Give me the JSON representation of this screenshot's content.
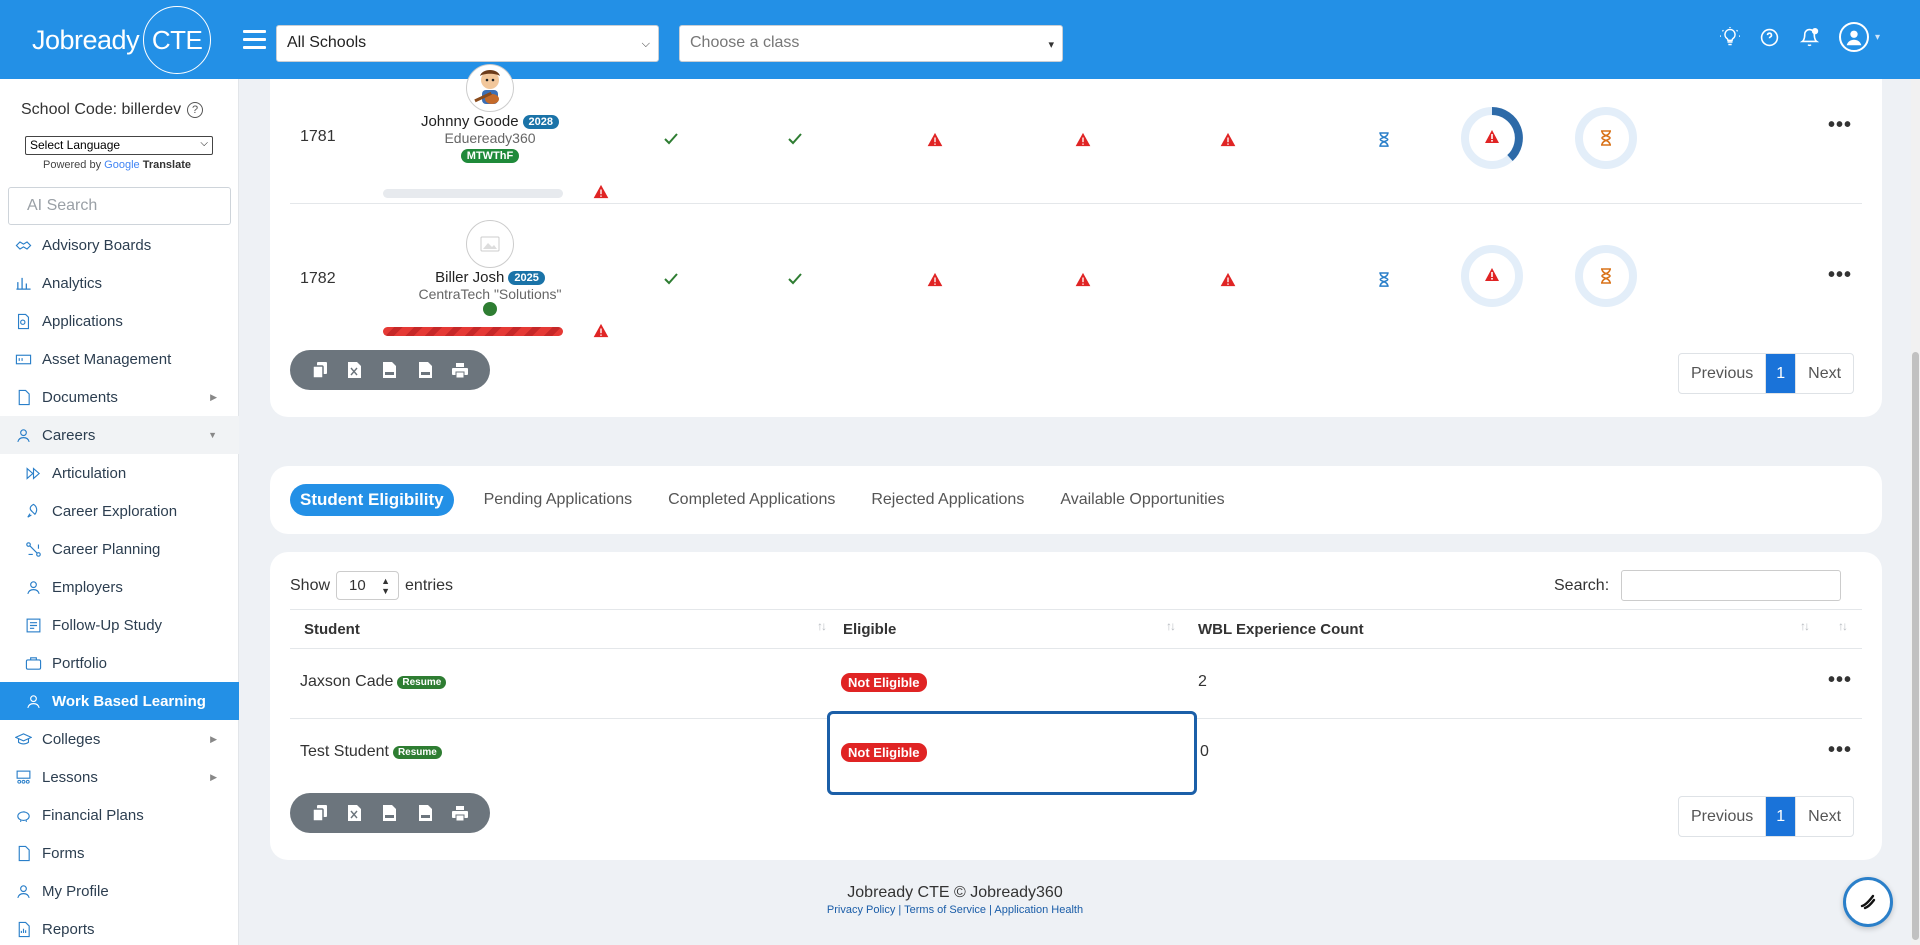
{
  "header": {
    "logo_text": "Jobready",
    "logo_badge": "CTE",
    "school_select": "All Schools",
    "class_select_placeholder": "Choose a class"
  },
  "sidebar": {
    "school_code": "School Code: billerdev",
    "language_select": "Select Language",
    "powered_by": "Powered by",
    "google": "Google",
    "translate": "Translate",
    "ai_search_placeholder": "AI Search",
    "items": [
      {
        "label": "Advisory Boards",
        "icon": "handshake-icon"
      },
      {
        "label": "Analytics",
        "icon": "bar-chart-icon"
      },
      {
        "label": "Applications",
        "icon": "document-search-icon"
      },
      {
        "label": "Asset Management",
        "icon": "asset-icon"
      },
      {
        "label": "Documents",
        "icon": "file-icon",
        "has_children": true
      },
      {
        "label": "Careers",
        "icon": "user-icon",
        "has_children": true,
        "expanded": true
      },
      {
        "label": "Articulation",
        "icon": "fast-forward-icon",
        "sub": true
      },
      {
        "label": "Career Exploration",
        "icon": "rocket-icon",
        "sub": true
      },
      {
        "label": "Career Planning",
        "icon": "flow-icon",
        "sub": true
      },
      {
        "label": "Employers",
        "icon": "user-icon",
        "sub": true
      },
      {
        "label": "Follow-Up Study",
        "icon": "study-icon",
        "sub": true
      },
      {
        "label": "Portfolio",
        "icon": "briefcase-icon",
        "sub": true
      },
      {
        "label": "Work Based Learning",
        "icon": "user-icon",
        "sub": true,
        "active": true
      },
      {
        "label": "Colleges",
        "icon": "graduation-cap-icon",
        "has_children": true
      },
      {
        "label": "Lessons",
        "icon": "classroom-icon",
        "has_children": true
      },
      {
        "label": "Financial Plans",
        "icon": "piggy-bank-icon"
      },
      {
        "label": "Forms",
        "icon": "file-icon"
      },
      {
        "label": "My Profile",
        "icon": "user-icon"
      },
      {
        "label": "Reports",
        "icon": "report-icon"
      }
    ]
  },
  "top_table": {
    "rows": [
      {
        "id": "1781",
        "name": "Johnny Goode",
        "year": "2028",
        "school": "Edueready360",
        "days": "MTWThF",
        "progress": 0
      },
      {
        "id": "1782",
        "name": "Biller Josh",
        "year": "2025",
        "school": "CentraTech \"Solutions\"",
        "days": "",
        "progress": 1.0
      }
    ],
    "pager": {
      "prev": "Previous",
      "page": "1",
      "next": "Next"
    }
  },
  "tabs": [
    "Student Eligibility",
    "Pending Applications",
    "Completed Applications",
    "Rejected Applications",
    "Available Opportunities"
  ],
  "eligibility_table": {
    "show": "Show",
    "entries_value": "10",
    "entries": "entries",
    "search_label": "Search:",
    "columns": [
      "Student",
      "Eligible",
      "WBL Experience Count"
    ],
    "rows": [
      {
        "student": "Jaxson Cade",
        "resume": "Resume",
        "eligible": "Not Eligible",
        "count": "2"
      },
      {
        "student": "Test Student",
        "resume": "Resume",
        "eligible": "Not Eligible",
        "count": "0"
      }
    ],
    "pager": {
      "prev": "Previous",
      "page": "1",
      "next": "Next"
    }
  },
  "footer": {
    "text": "Jobready CTE © Jobready360",
    "links": "Privacy Policy | Terms of Service | Application Health"
  },
  "colors": {
    "primary": "#2390e6",
    "danger": "#e02424",
    "success": "#2e7d32"
  }
}
